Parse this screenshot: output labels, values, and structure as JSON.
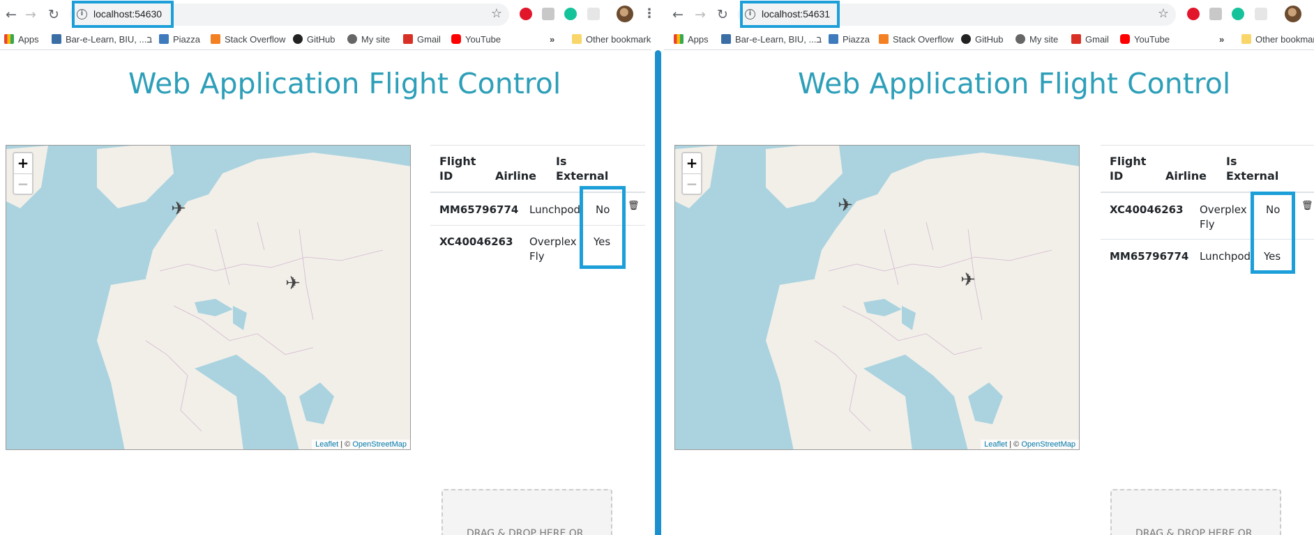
{
  "left": {
    "url": "localhost:54630",
    "title": "Web Application Flight Control",
    "headers": {
      "flight_id": "Flight ID",
      "airline": "Airline",
      "is_external": "Is External"
    },
    "flights": [
      {
        "id": "MM65796774",
        "airline": "Lunchpod",
        "external": "No"
      },
      {
        "id": "XC40046263",
        "airline": "Overplex Fly",
        "external": "Yes"
      }
    ]
  },
  "right": {
    "url": "localhost:54631",
    "title": "Web Application Flight Control",
    "headers": {
      "flight_id": "Flight ID",
      "airline": "Airline",
      "is_external": "Is External"
    },
    "flights": [
      {
        "id": "XC40046263",
        "airline": "Overplex Fly",
        "external": "No"
      },
      {
        "id": "MM65796774",
        "airline": "Lunchpod",
        "external": "Yes"
      }
    ]
  },
  "bookmarks": [
    "Apps",
    "Bar-e-Learn, BIU, ...ב",
    "Piazza",
    "Stack Overflow",
    "GitHub",
    "My site",
    "Gmail",
    "YouTube"
  ],
  "bookmarks_overflow": "»",
  "other_bookmarks": "Other bookmarks",
  "other_bookmarks_right": "Other bookmar",
  "map": {
    "zoom_in": "+",
    "zoom_out": "−",
    "attribution_leaflet": "Leaflet",
    "attribution_sep": " | © ",
    "attribution_osm": "OpenStreetMap"
  },
  "plane_glyph": "✈",
  "trash_glyph": "🗑",
  "dropzone_text": "DRAG & DROP HERE OR",
  "colors": {
    "title": "#2d9fb8",
    "highlight": "#1c9fd8",
    "divider": "#1c8fcf",
    "water": "#aad3df",
    "land": "#f2efe9"
  },
  "icons": [
    "back-arrow-icon",
    "forward-arrow-icon",
    "reload-icon",
    "info-icon",
    "star-icon",
    "opera-icon",
    "extension-icon",
    "grammarly-icon",
    "avatar",
    "menu-icon",
    "apps-grid-icon",
    "folder-icon",
    "plane-icon",
    "trash-icon"
  ]
}
